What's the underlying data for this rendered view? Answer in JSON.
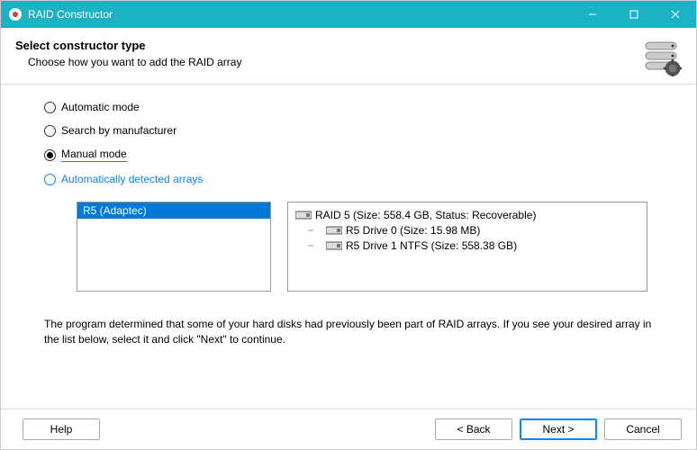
{
  "window": {
    "title": "RAID Constructor"
  },
  "header": {
    "title": "Select constructor type",
    "subtitle": "Choose how you want to add the RAID array"
  },
  "options": {
    "automatic": "Automatic mode",
    "search_mfr": "Search by manufacturer",
    "manual": "Manual mode",
    "auto_detect": "Automatically detected arrays",
    "selected": "manual"
  },
  "left_list": {
    "items": [
      "R5 (Adaptec)"
    ]
  },
  "tree": {
    "root": "RAID 5 (Size: 558.4 GB, Status: Recoverable)",
    "children": [
      "R5 Drive 0 (Size: 15.98 MB)",
      "R5 Drive 1 NTFS (Size: 558.38 GB)"
    ]
  },
  "description": "The program determined that some of your hard disks had previously been part of RAID arrays. If you see your desired array in the list below, select it and click \"Next\" to continue.",
  "buttons": {
    "help": "Help",
    "back": "< Back",
    "next": "Next >",
    "cancel": "Cancel"
  }
}
